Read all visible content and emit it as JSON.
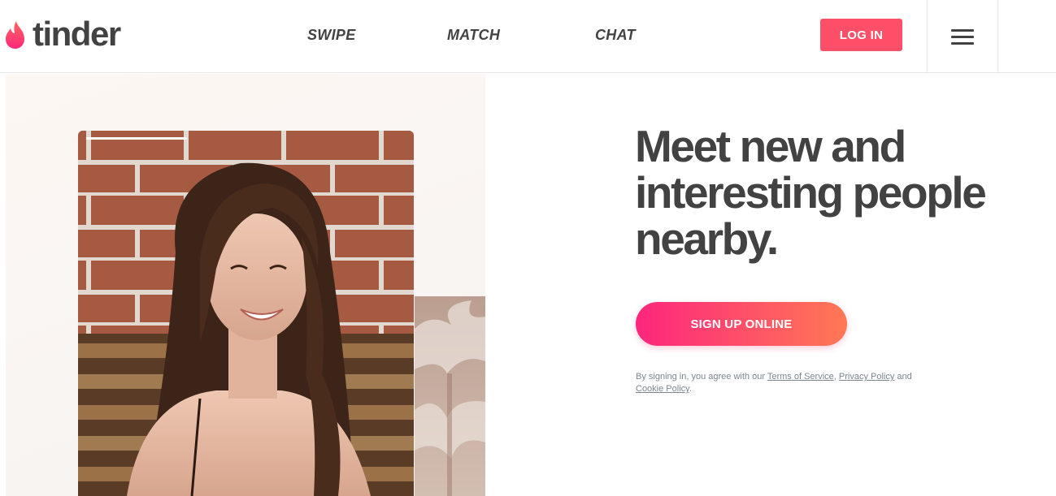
{
  "brand": {
    "name": "tinder",
    "accent_color": "#fd5068",
    "gradient_start": "#fd267d",
    "gradient_end": "#ff7854",
    "logo_icon": "flame-icon"
  },
  "nav": {
    "links": [
      {
        "label": "SWIPE"
      },
      {
        "label": "MATCH"
      },
      {
        "label": "CHAT"
      }
    ],
    "login_label": "LOG IN",
    "menu_icon": "hamburger-icon"
  },
  "hero": {
    "image": "profile-photo",
    "headline": "Meet new and interesting people nearby.",
    "signup_label": "SIGN UP ONLINE",
    "legal": {
      "prefix": "By signing in, you agree with our ",
      "terms": "Terms of Service",
      "sep1": ", ",
      "privacy": "Privacy Policy",
      "sep2": " and",
      "cookie": "Cookie Policy",
      "suffix": "."
    }
  }
}
